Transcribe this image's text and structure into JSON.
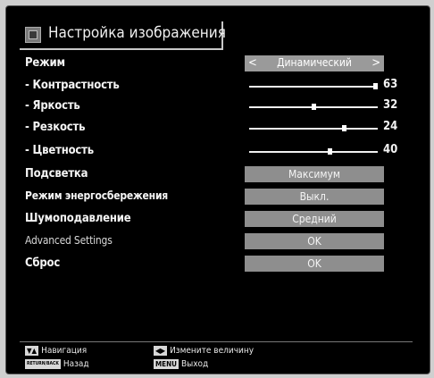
{
  "title": "Настройка изображения",
  "rows": [
    {
      "label": "Режим",
      "value": "Динамический"
    },
    {
      "label": "- Контрастность",
      "value": "63",
      "level": 1.0
    },
    {
      "label": "- Яркость",
      "value": "32",
      "level": 0.5
    },
    {
      "label": "- Резкость",
      "value": "24",
      "level": 0.75
    },
    {
      "label": "- Цветность",
      "value": "40",
      "level": 0.63
    },
    {
      "label": "Подсветка",
      "value": "Максимум"
    },
    {
      "label": "Режим энергосбережения",
      "value": "Выкл."
    },
    {
      "label": "Шумоподавление",
      "value": "Средний"
    },
    {
      "label": "Advanced Settings",
      "value": "OK"
    },
    {
      "label": "Сброс",
      "value": "OK"
    }
  ],
  "footer": {
    "nav_label": "Навигация",
    "change_label": "Измените величину",
    "back_key": "RETURN/BACK",
    "back_label": "Назад",
    "menu_key": "MENU",
    "menu_label": "Выход"
  }
}
